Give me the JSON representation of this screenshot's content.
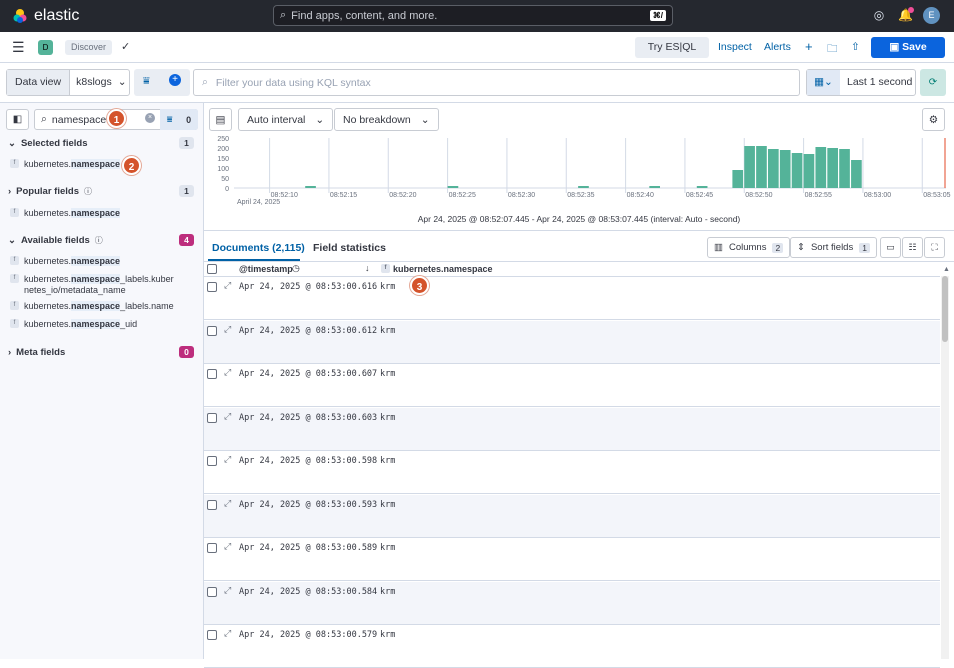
{
  "brand": "elastic",
  "search": {
    "placeholder": "Find apps, content, and more.",
    "shortcut": "⌘/"
  },
  "user": {
    "initial": "E"
  },
  "space": {
    "initial": "D"
  },
  "breadcrumb": "Discover",
  "toolbar": {
    "try_esql": "Try ES|QL",
    "inspect": "Inspect",
    "alerts": "Alerts",
    "save": "Save"
  },
  "dataview": {
    "label": "Data view",
    "value": "k8slogs"
  },
  "kql": {
    "placeholder": "Filter your data using KQL syntax"
  },
  "time": {
    "label": "Last 1 second"
  },
  "sidebar": {
    "search_value": "namespace",
    "filter_count": "0",
    "selected": {
      "title": "Selected fields",
      "count": "1",
      "fields": [
        [
          "kubernetes.",
          "namespace",
          ""
        ]
      ]
    },
    "popular": {
      "title": "Popular fields",
      "count": "1",
      "fields": [
        [
          "kubernetes.",
          "namespace",
          ""
        ]
      ]
    },
    "available": {
      "title": "Available fields",
      "count": "4",
      "fields": [
        [
          "kubernetes.",
          "namespace",
          ""
        ],
        [
          "kubernetes.",
          "namespace",
          "_labels.kuber"
        ],
        [
          "kubernetes.",
          "namespace",
          "_labels.name"
        ],
        [
          "kubernetes.",
          "namespace",
          "_uid"
        ]
      ],
      "wrap_line": "netes_io/metadata_name"
    },
    "meta": {
      "title": "Meta fields",
      "count": "0"
    }
  },
  "steps": [
    "1",
    "2",
    "3"
  ],
  "chart": {
    "interval": "Auto interval",
    "breakdown": "No breakdown",
    "yticks": [
      "250",
      "200",
      "150",
      "100",
      "50",
      "0"
    ],
    "xticks": [
      "08:52:10",
      "08:52:15",
      "08:52:20",
      "08:52:25",
      "08:52:30",
      "08:52:35",
      "08:52:40",
      "08:52:45",
      "08:52:50",
      "08:52:55",
      "08:53:00",
      "08:53:05"
    ],
    "date_label": "April 24, 2025",
    "range": "Apr 24, 2025 @ 08:52:07.445 - Apr 24, 2025 @ 08:53:07.445 (interval: Auto - second)"
  },
  "chart_data": {
    "type": "bar",
    "ylim": [
      0,
      250
    ],
    "x": [
      "08:52:49",
      "08:52:50",
      "08:52:51",
      "08:52:52",
      "08:52:53",
      "08:52:54",
      "08:52:55",
      "08:52:56",
      "08:52:57",
      "08:52:58",
      "08:52:59"
    ],
    "values": [
      90,
      210,
      210,
      195,
      190,
      175,
      170,
      205,
      200,
      195,
      140
    ],
    "small": [
      [
        "08:52:13",
        5
      ],
      [
        "08:52:25",
        5
      ],
      [
        "08:52:36",
        5
      ],
      [
        "08:52:42",
        5
      ],
      [
        "08:52:46",
        5
      ]
    ]
  },
  "tabs": {
    "documents": "Documents (2,115)",
    "field_stats": "Field statistics"
  },
  "table": {
    "columns_label": "Columns",
    "columns_count": "2",
    "sort_label": "Sort fields",
    "sort_count": "1",
    "headers": {
      "timestamp": "@timestamp",
      "namespace": "kubernetes.namespace"
    },
    "rows": [
      {
        "ts": "Apr 24, 2025 @ 08:53:00.616",
        "ns": "krm"
      },
      {
        "ts": "Apr 24, 2025 @ 08:53:00.612",
        "ns": "krm"
      },
      {
        "ts": "Apr 24, 2025 @ 08:53:00.607",
        "ns": "krm"
      },
      {
        "ts": "Apr 24, 2025 @ 08:53:00.603",
        "ns": "krm"
      },
      {
        "ts": "Apr 24, 2025 @ 08:53:00.598",
        "ns": "krm"
      },
      {
        "ts": "Apr 24, 2025 @ 08:53:00.593",
        "ns": "krm"
      },
      {
        "ts": "Apr 24, 2025 @ 08:53:00.589",
        "ns": "krm"
      },
      {
        "ts": "Apr 24, 2025 @ 08:53:00.584",
        "ns": "krm"
      },
      {
        "ts": "Apr 24, 2025 @ 08:53:00.579",
        "ns": "krm"
      }
    ]
  }
}
